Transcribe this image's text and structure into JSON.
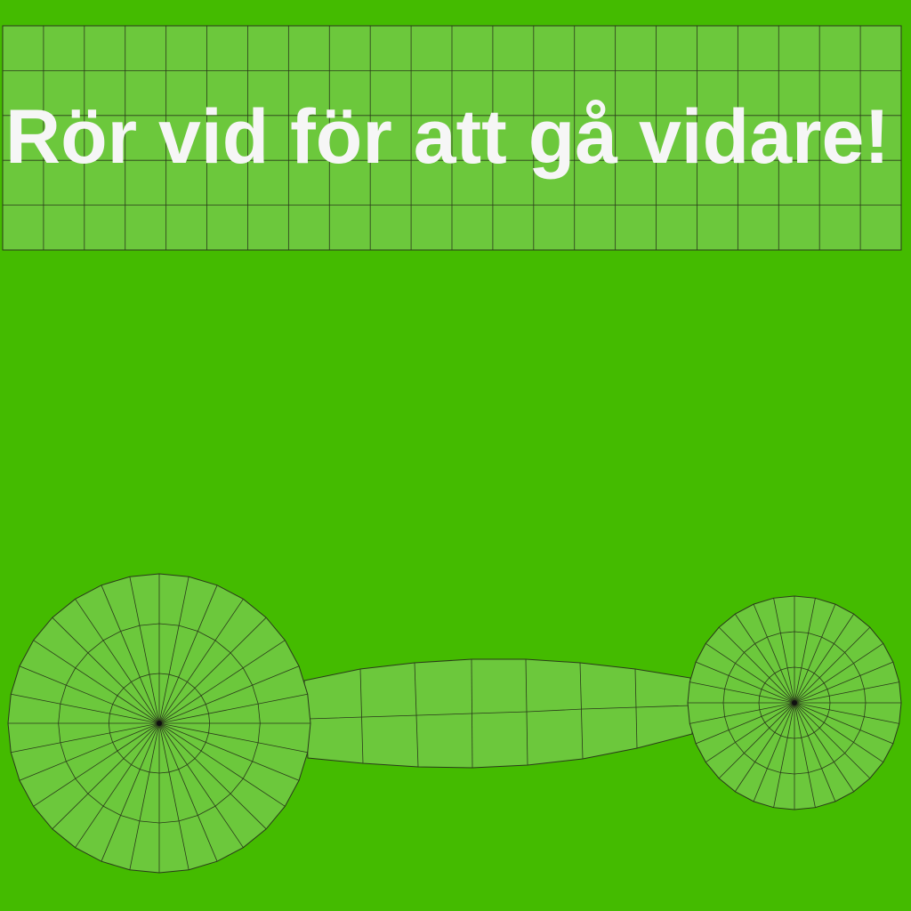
{
  "banner": {
    "text": "Rör vid för att gå vidare!"
  },
  "colors": {
    "background": "#44bb00",
    "mesh_fill": "#6cc83c",
    "mesh_line": "#2a3a1a",
    "text": "#f6f6f6"
  },
  "mesh": {
    "banner_grid": {
      "columns": 22,
      "rows": 5
    },
    "left_disc": {
      "spokes": 32,
      "rings": 3
    },
    "right_disc": {
      "spokes": 32,
      "rings": 3
    },
    "bridge": {
      "columns": 7,
      "rows": 2
    }
  }
}
